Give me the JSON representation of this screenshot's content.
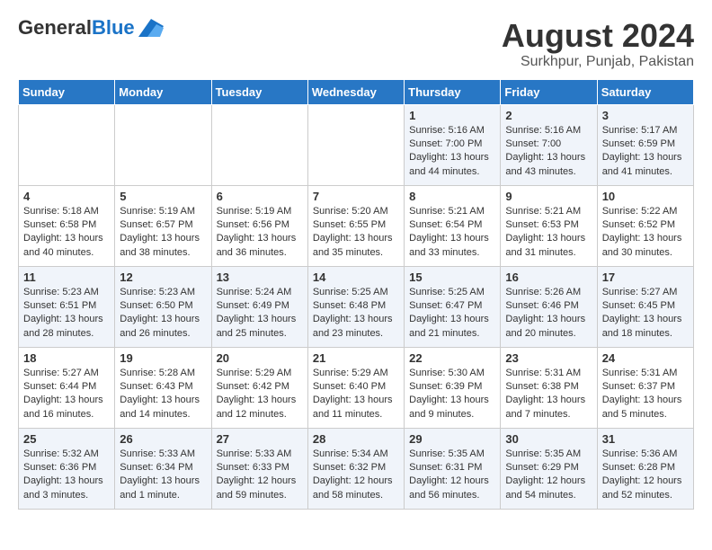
{
  "header": {
    "logo_line1": "General",
    "logo_line2": "Blue",
    "month_year": "August 2024",
    "location": "Surkhpur, Punjab, Pakistan"
  },
  "weekdays": [
    "Sunday",
    "Monday",
    "Tuesday",
    "Wednesday",
    "Thursday",
    "Friday",
    "Saturday"
  ],
  "weeks": [
    [
      {
        "day": "",
        "sunrise": "",
        "sunset": "",
        "daylight": ""
      },
      {
        "day": "",
        "sunrise": "",
        "sunset": "",
        "daylight": ""
      },
      {
        "day": "",
        "sunrise": "",
        "sunset": "",
        "daylight": ""
      },
      {
        "day": "",
        "sunrise": "",
        "sunset": "",
        "daylight": ""
      },
      {
        "day": "1",
        "sunrise": "5:16 AM",
        "sunset": "7:00 PM",
        "daylight": "13 hours and 44 minutes."
      },
      {
        "day": "2",
        "sunrise": "5:16 AM",
        "sunset": "7:00",
        "daylight": "13 hours and 43 minutes."
      },
      {
        "day": "3",
        "sunrise": "5:17 AM",
        "sunset": "6:59 PM",
        "daylight": "13 hours and 41 minutes."
      }
    ],
    [
      {
        "day": "4",
        "sunrise": "5:18 AM",
        "sunset": "6:58 PM",
        "daylight": "13 hours and 40 minutes."
      },
      {
        "day": "5",
        "sunrise": "5:19 AM",
        "sunset": "6:57 PM",
        "daylight": "13 hours and 38 minutes."
      },
      {
        "day": "6",
        "sunrise": "5:19 AM",
        "sunset": "6:56 PM",
        "daylight": "13 hours and 36 minutes."
      },
      {
        "day": "7",
        "sunrise": "5:20 AM",
        "sunset": "6:55 PM",
        "daylight": "13 hours and 35 minutes."
      },
      {
        "day": "8",
        "sunrise": "5:21 AM",
        "sunset": "6:54 PM",
        "daylight": "13 hours and 33 minutes."
      },
      {
        "day": "9",
        "sunrise": "5:21 AM",
        "sunset": "6:53 PM",
        "daylight": "13 hours and 31 minutes."
      },
      {
        "day": "10",
        "sunrise": "5:22 AM",
        "sunset": "6:52 PM",
        "daylight": "13 hours and 30 minutes."
      }
    ],
    [
      {
        "day": "11",
        "sunrise": "5:23 AM",
        "sunset": "6:51 PM",
        "daylight": "13 hours and 28 minutes."
      },
      {
        "day": "12",
        "sunrise": "5:23 AM",
        "sunset": "6:50 PM",
        "daylight": "13 hours and 26 minutes."
      },
      {
        "day": "13",
        "sunrise": "5:24 AM",
        "sunset": "6:49 PM",
        "daylight": "13 hours and 25 minutes."
      },
      {
        "day": "14",
        "sunrise": "5:25 AM",
        "sunset": "6:48 PM",
        "daylight": "13 hours and 23 minutes."
      },
      {
        "day": "15",
        "sunrise": "5:25 AM",
        "sunset": "6:47 PM",
        "daylight": "13 hours and 21 minutes."
      },
      {
        "day": "16",
        "sunrise": "5:26 AM",
        "sunset": "6:46 PM",
        "daylight": "13 hours and 20 minutes."
      },
      {
        "day": "17",
        "sunrise": "5:27 AM",
        "sunset": "6:45 PM",
        "daylight": "13 hours and 18 minutes."
      }
    ],
    [
      {
        "day": "18",
        "sunrise": "5:27 AM",
        "sunset": "6:44 PM",
        "daylight": "13 hours and 16 minutes."
      },
      {
        "day": "19",
        "sunrise": "5:28 AM",
        "sunset": "6:43 PM",
        "daylight": "13 hours and 14 minutes."
      },
      {
        "day": "20",
        "sunrise": "5:29 AM",
        "sunset": "6:42 PM",
        "daylight": "13 hours and 12 minutes."
      },
      {
        "day": "21",
        "sunrise": "5:29 AM",
        "sunset": "6:40 PM",
        "daylight": "13 hours and 11 minutes."
      },
      {
        "day": "22",
        "sunrise": "5:30 AM",
        "sunset": "6:39 PM",
        "daylight": "13 hours and 9 minutes."
      },
      {
        "day": "23",
        "sunrise": "5:31 AM",
        "sunset": "6:38 PM",
        "daylight": "13 hours and 7 minutes."
      },
      {
        "day": "24",
        "sunrise": "5:31 AM",
        "sunset": "6:37 PM",
        "daylight": "13 hours and 5 minutes."
      }
    ],
    [
      {
        "day": "25",
        "sunrise": "5:32 AM",
        "sunset": "6:36 PM",
        "daylight": "13 hours and 3 minutes."
      },
      {
        "day": "26",
        "sunrise": "5:33 AM",
        "sunset": "6:34 PM",
        "daylight": "13 hours and 1 minute."
      },
      {
        "day": "27",
        "sunrise": "5:33 AM",
        "sunset": "6:33 PM",
        "daylight": "12 hours and 59 minutes."
      },
      {
        "day": "28",
        "sunrise": "5:34 AM",
        "sunset": "6:32 PM",
        "daylight": "12 hours and 58 minutes."
      },
      {
        "day": "29",
        "sunrise": "5:35 AM",
        "sunset": "6:31 PM",
        "daylight": "12 hours and 56 minutes."
      },
      {
        "day": "30",
        "sunrise": "5:35 AM",
        "sunset": "6:29 PM",
        "daylight": "12 hours and 54 minutes."
      },
      {
        "day": "31",
        "sunrise": "5:36 AM",
        "sunset": "6:28 PM",
        "daylight": "12 hours and 52 minutes."
      }
    ]
  ]
}
